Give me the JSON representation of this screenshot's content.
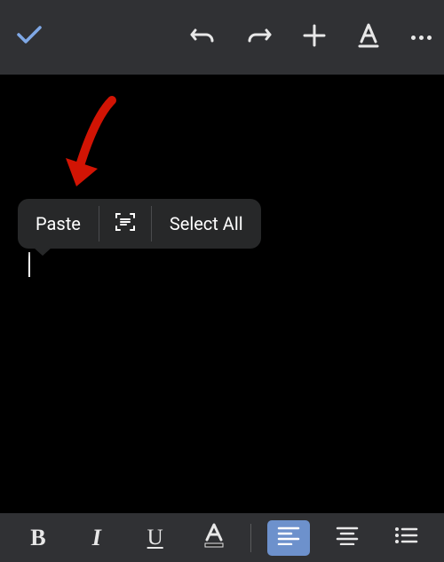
{
  "toolbar_top": {
    "confirm_icon": "checkmark",
    "undo_icon": "undo",
    "redo_icon": "redo",
    "add_icon": "plus",
    "text_style_icon": "text-style",
    "more_icon": "more"
  },
  "context_menu": {
    "paste_label": "Paste",
    "scan_icon": "scan",
    "select_all_label": "Select All"
  },
  "formatting": {
    "bold_label": "B",
    "italic_label": "I",
    "underline_label": "U",
    "text_color_label": "A",
    "align_left_icon": "align-left",
    "align_center_icon": "align-center",
    "list_icon": "bulleted-list"
  },
  "colors": {
    "accent": "#6d91cc",
    "checkmark": "#7fa8e6",
    "toolbar_bg": "#303134",
    "editor_bg": "#000000",
    "menu_bg": "#272829",
    "annotation": "#d21404"
  }
}
